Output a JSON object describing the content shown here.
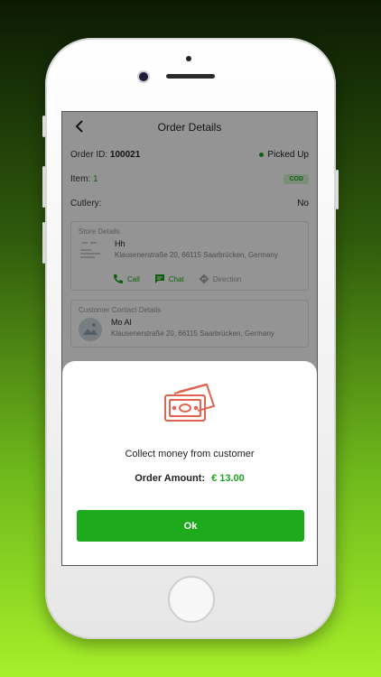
{
  "header": {
    "title": "Order Details"
  },
  "order": {
    "id_label": "Order ID:",
    "id_value": "100021",
    "status": "Picked Up",
    "item_label": "Item:",
    "item_value": "1",
    "payment_badge": "COD",
    "cutlery_label": "Cutlery:",
    "cutlery_value": "No"
  },
  "store": {
    "section_title": "Store Details",
    "name": "Hh",
    "address": "Klausenerstraße 20, 66115 Saarbrücken, Germany",
    "actions": {
      "call": "Call",
      "chat": "Chat",
      "direction": "Direction"
    }
  },
  "customer": {
    "section_title": "Customer Contact Details",
    "name": "Mo Al",
    "address": "Klausenerstraße 20, 66115 Saarbrücken, Germany"
  },
  "dialog": {
    "message": "Collect money from customer",
    "amount_label": "Order Amount:",
    "amount_value": "€ 13.00",
    "ok_label": "Ok"
  },
  "colors": {
    "accent": "#1da51d",
    "money_icon": "#e2624f",
    "cod_badge_bg": "#d7f3d0"
  }
}
